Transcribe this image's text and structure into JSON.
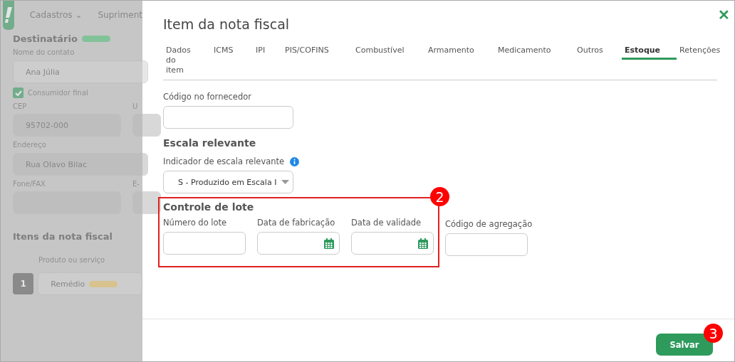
{
  "background": {
    "nav": [
      {
        "label": "Cadastros",
        "caret": "⌄"
      },
      {
        "label": "Supriment"
      }
    ],
    "recipient": {
      "title": "Destinatário",
      "contact_label": "Nome do contato",
      "contact_value": "Ana Júlia",
      "final_consumer": {
        "label": "Consumidor final",
        "checked": true
      },
      "cep_label": "CEP",
      "cep_value": "95702-000",
      "uf_label": "U",
      "address_label": "Endereço",
      "address_value": "Rua Olavo Bilac",
      "phone_label": "Fone/FAX",
      "email_label": "E-"
    },
    "items": {
      "title": "Itens da nota fiscal",
      "column": "Produto ou serviço",
      "row_number": "1",
      "product": "Remédio"
    }
  },
  "modal": {
    "title": "Item da nota fiscal",
    "close": "✕",
    "tabs": [
      {
        "label": "Dados do item",
        "selected": false
      },
      {
        "label": "ICMS",
        "selected": false
      },
      {
        "label": "IPI",
        "selected": false
      },
      {
        "label": "PIS/COFINS",
        "selected": false
      },
      {
        "label": "Combustível",
        "selected": false
      },
      {
        "label": "Armamento",
        "selected": false
      },
      {
        "label": "Medicamento",
        "selected": false
      },
      {
        "label": "Outros",
        "selected": false
      },
      {
        "label": "Estoque",
        "selected": true
      },
      {
        "label": "Retenções",
        "selected": false
      }
    ],
    "supplier_code": {
      "label": "Código no fornecedor"
    },
    "scale": {
      "title": "Escala relevante",
      "label": "Indicador de escala relevante",
      "value": "S - Produzido em Escala I"
    },
    "lot": {
      "title": "Controle de lote",
      "badge": "2",
      "fields": [
        {
          "label": "Número do lote",
          "kind": "text"
        },
        {
          "label": "Data de fabricação",
          "kind": "date"
        },
        {
          "label": "Data de validade",
          "kind": "date"
        }
      ]
    },
    "aggregation": {
      "label": "Código de agregação"
    },
    "save": {
      "label": "Salvar",
      "badge": "3"
    }
  }
}
